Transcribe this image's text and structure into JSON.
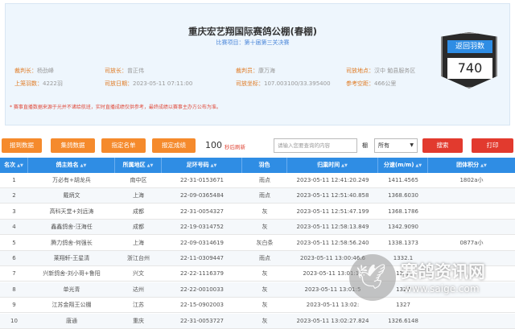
{
  "header": {
    "title": "重庆宏艺翔国际赛鸽公棚(春棚)",
    "subtitle": "比赛项目：第十届第三关决赛",
    "info": [
      {
        "k": "裁判长：",
        "v": "杨劲峰"
      },
      {
        "k": "司放长：",
        "v": "曾正伟"
      },
      {
        "k": "裁判员：",
        "v": "康万海"
      },
      {
        "k": "司放地点：",
        "v": "汉中 勉县服务区"
      },
      {
        "k": "上笼羽数：",
        "v": "4222羽"
      },
      {
        "k": "司放日期：",
        "v": "2023-05-11 07:11:00"
      },
      {
        "k": "司放坐标：",
        "v": "107.003100/33.395400"
      },
      {
        "k": "参考空距：",
        "v": "466公里"
      }
    ],
    "notice": "* 赛事直播数据来源于光并不诸给航班，实时直播成绩仅供参考，最终成绩以赛事主办方公布为准。"
  },
  "badge": {
    "title": "返回羽数",
    "count": "740"
  },
  "toolbar": {
    "buttons": [
      "报到数据",
      "集鸽数据",
      "指定名单",
      "报定成绩"
    ],
    "count": "100",
    "count_label": "秒后刷新",
    "search_placeholder": "请输入您要查询的内容",
    "shed_label": "棚",
    "shed_value": "所有",
    "search_button": "搜索",
    "print_button": "打印"
  },
  "table": {
    "columns": [
      "名次",
      "鸽主姓名",
      "所属地区",
      "足环号码",
      "羽色",
      "归巢时间",
      "分速(m/m)",
      "团体积分"
    ],
    "rows": [
      [
        "1",
        "万必有+胡龙兵",
        "南中区",
        "22-31-0153671",
        "雨点",
        "2023-05-11 12:41:20.249",
        "1411.4565",
        "1802a小"
      ],
      [
        "2",
        "戴炳文",
        "上海",
        "22-09-0365484",
        "雨点",
        "2023-05-11 12:51:40.858",
        "1368.6030",
        ""
      ],
      [
        "3",
        "高科天堂+刘远涛",
        "成都",
        "22-31-0054327",
        "灰",
        "2023-05-11 12:51:47.199",
        "1368.1786",
        ""
      ],
      [
        "4",
        "鑫鑫鸽舍-汪海任",
        "成都",
        "22-19-0314752",
        "灰",
        "2023-05-11 12:58:13.849",
        "1342.9090",
        ""
      ],
      [
        "5",
        "腾力鸽舍-何强长",
        "上海",
        "22-09-0314619",
        "灰白条",
        "2023-05-11 12:58:56.240",
        "1338.1373",
        "0877a小"
      ],
      [
        "6",
        "莱翔轩-王星清",
        "浙江台州",
        "22-11-0309447",
        "雨点",
        "2023-05-11 13:00:46.6",
        "1332.1",
        ""
      ],
      [
        "7",
        "兴新鸽舍-刘小哥+鲁阳",
        "兴文",
        "22-22-1116379",
        "灰",
        "2023-05-11 13:01:12",
        "1330",
        ""
      ],
      [
        "8",
        "单光青",
        "达州",
        "22-22-0010033",
        "灰",
        "2023-05-11 13:01:5",
        "1327",
        ""
      ],
      [
        "9",
        "江苏金翔王公棚",
        "江苏",
        "22-15-0902003",
        "灰",
        "2023-05-11 13:02:",
        "1327",
        ""
      ],
      [
        "10",
        "唐通",
        "重庆",
        "22-31-0053727",
        "灰",
        "2023-05-11 13:02:27.824",
        "1326.6148",
        ""
      ]
    ]
  },
  "watermark": {
    "text": "赛鸽资讯网",
    "url": "www.saige.com"
  }
}
